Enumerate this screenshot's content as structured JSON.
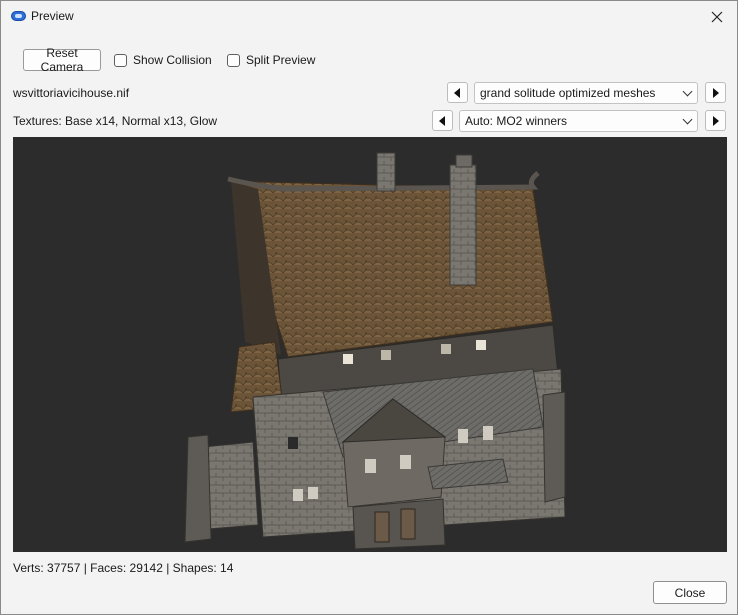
{
  "window": {
    "title": "Preview",
    "app_icon": "preview-app-icon",
    "close_icon": "close-x-icon"
  },
  "toolbar": {
    "reset_camera_label": "Reset Camera",
    "show_collision_label": "Show Collision",
    "show_collision_checked": false,
    "split_preview_label": "Split Preview",
    "split_preview_checked": false
  },
  "mesh": {
    "filename": "wsvittoriavicihouse.nif",
    "source_selected": "grand solitude optimized meshes",
    "prev_icon": "triangle-left-icon",
    "next_icon": "triangle-right-icon"
  },
  "textures": {
    "summary": "Textures: Base x14, Normal x13, Glow",
    "source_selected": "Auto: MO2 winners"
  },
  "stats": {
    "text": "Verts: 37757 | Faces: 29142 | Shapes: 14"
  },
  "footer": {
    "close_label": "Close"
  }
}
